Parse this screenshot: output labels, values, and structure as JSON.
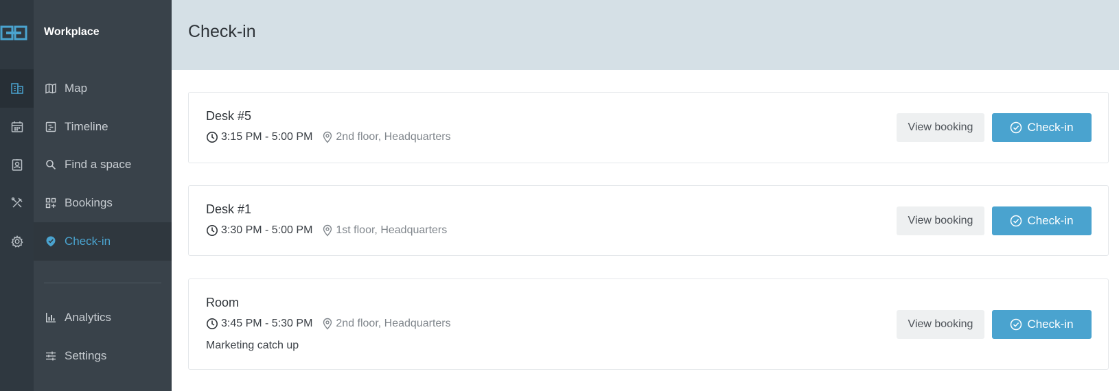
{
  "app": {
    "brand": "Workplace"
  },
  "colors": {
    "accent": "#4aa3cf",
    "rail": "#2f3840",
    "sidebar": "#39424a",
    "header": "#d5e0e6"
  },
  "rail": {
    "items": [
      "building-icon",
      "calendar-icon",
      "badge-icon",
      "tools-icon",
      "gear-icon"
    ],
    "active": 0
  },
  "sidebar": {
    "items": [
      {
        "label": "Map",
        "icon": "map-icon"
      },
      {
        "label": "Timeline",
        "icon": "timeline-icon"
      },
      {
        "label": "Find a space",
        "icon": "search-icon"
      },
      {
        "label": "Bookings",
        "icon": "bookings-icon"
      },
      {
        "label": "Check-in",
        "icon": "check-badge-icon",
        "active": true
      }
    ],
    "bottom_items": [
      {
        "label": "Analytics",
        "icon": "analytics-icon"
      },
      {
        "label": "Settings",
        "icon": "sliders-icon"
      }
    ]
  },
  "header": {
    "title": "Check-in"
  },
  "bookings": [
    {
      "title": "Desk #5",
      "time": "3:15 PM - 5:00 PM",
      "location": "2nd floor, Headquarters",
      "note": ""
    },
    {
      "title": "Desk #1",
      "time": "3:30 PM - 5:00 PM",
      "location": "1st floor, Headquarters",
      "note": ""
    },
    {
      "title": "Room",
      "time": "3:45 PM - 5:30 PM",
      "location": "2nd floor, Headquarters",
      "note": "Marketing catch up"
    }
  ],
  "actions": {
    "view_label": "View booking",
    "checkin_label": "Check-in"
  }
}
